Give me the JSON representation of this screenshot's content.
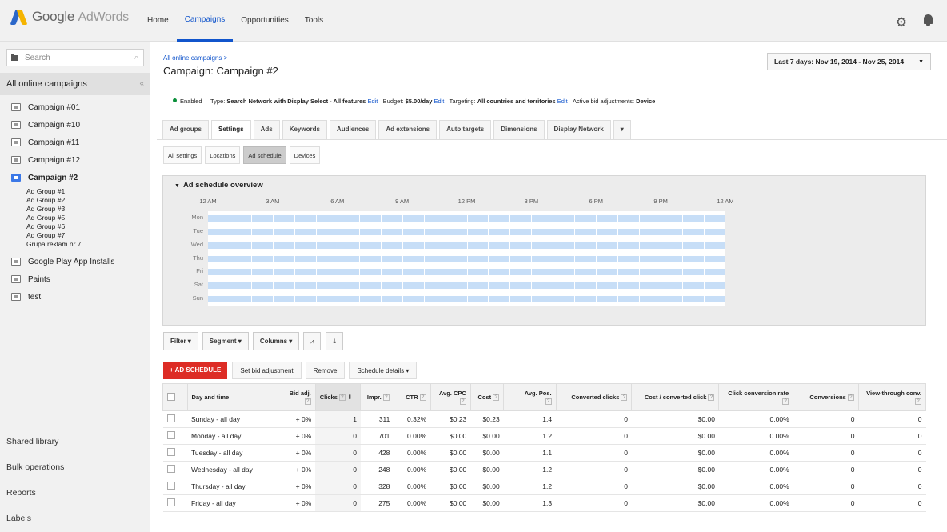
{
  "topbar": {
    "logo_google": "Google",
    "logo_product": "AdWords",
    "nav": [
      "Home",
      "Campaigns",
      "Opportunities",
      "Tools"
    ],
    "active_nav": "Campaigns"
  },
  "sidebar": {
    "search_placeholder": "Search",
    "all_campaigns": "All online campaigns",
    "collapse_glyph": "«",
    "campaigns": [
      {
        "name": "Campaign #01"
      },
      {
        "name": "Campaign #10"
      },
      {
        "name": "Campaign #11"
      },
      {
        "name": "Campaign #12"
      },
      {
        "name": "Campaign #2",
        "selected": true
      }
    ],
    "ad_groups": [
      "Ad Group #1",
      "Ad Group #2",
      "Ad Group #3",
      "Ad Group #5",
      "Ad Group #6",
      "Ad Group #7",
      "Grupa reklam nr 7"
    ],
    "other_campaigns": [
      "Google Play App Installs",
      "Paints",
      "test"
    ],
    "bottom": [
      "Shared library",
      "Bulk operations",
      "Reports",
      "Labels"
    ]
  },
  "main": {
    "breadcrumb": "All online campaigns >",
    "title": "Campaign: Campaign #2",
    "date_range": "Last 7 days: Nov 19, 2014 - Nov 25, 2014",
    "status": {
      "state": "Enabled",
      "type_label": "Type:",
      "type_value": "Search Network with Display Select - All features",
      "edit": "Edit",
      "budget_label": "Budget:",
      "budget_value": "$5.00/day",
      "targeting_label": "Targeting:",
      "targeting_value": "All countries and territories",
      "bid_label": "Active bid adjustments:",
      "bid_value": "Device"
    },
    "tabs": [
      "Ad groups",
      "Settings",
      "Ads",
      "Keywords",
      "Audiences",
      "Ad extensions",
      "Auto targets",
      "Dimensions",
      "Display Network",
      "▾"
    ],
    "active_tab": "Settings",
    "subtabs": [
      "All settings",
      "Locations",
      "Ad schedule",
      "Devices"
    ],
    "active_subtab": "Ad schedule"
  },
  "schedule": {
    "title": "Ad schedule overview",
    "hours": [
      "12 AM",
      "3 AM",
      "6 AM",
      "9 AM",
      "12 PM",
      "3 PM",
      "6 PM",
      "9 PM",
      "12 AM"
    ],
    "days": [
      "Mon",
      "Tue",
      "Wed",
      "Thu",
      "Fri",
      "Sat",
      "Sun"
    ]
  },
  "toolbar": {
    "filter": "Filter ▾",
    "segment": "Segment ▾",
    "columns": "Columns ▾",
    "chart_glyph": "⩘",
    "download_glyph": "⤓"
  },
  "actions": {
    "add": "+ AD SCHEDULE",
    "set_bid": "Set bid adjustment",
    "remove": "Remove",
    "details": "Schedule details ▾"
  },
  "table": {
    "headers": [
      "Day and time",
      "Bid adj.",
      "Clicks",
      "Impr.",
      "CTR",
      "Avg. CPC",
      "Cost",
      "Avg. Pos.",
      "Converted clicks",
      "Cost / converted click",
      "Click conversion rate",
      "Conversions",
      "View-through conv."
    ],
    "help_glyph": "?",
    "sort_glyph": "⬇",
    "rows": [
      [
        "Sunday - all day",
        "+ 0%",
        "1",
        "311",
        "0.32%",
        "$0.23",
        "$0.23",
        "1.4",
        "0",
        "$0.00",
        "0.00%",
        "0",
        "0"
      ],
      [
        "Monday - all day",
        "+ 0%",
        "0",
        "701",
        "0.00%",
        "$0.00",
        "$0.00",
        "1.2",
        "0",
        "$0.00",
        "0.00%",
        "0",
        "0"
      ],
      [
        "Tuesday - all day",
        "+ 0%",
        "0",
        "428",
        "0.00%",
        "$0.00",
        "$0.00",
        "1.1",
        "0",
        "$0.00",
        "0.00%",
        "0",
        "0"
      ],
      [
        "Wednesday - all day",
        "+ 0%",
        "0",
        "248",
        "0.00%",
        "$0.00",
        "$0.00",
        "1.2",
        "0",
        "$0.00",
        "0.00%",
        "0",
        "0"
      ],
      [
        "Thursday - all day",
        "+ 0%",
        "0",
        "328",
        "0.00%",
        "$0.00",
        "$0.00",
        "1.2",
        "0",
        "$0.00",
        "0.00%",
        "0",
        "0"
      ],
      [
        "Friday - all day",
        "+ 0%",
        "0",
        "275",
        "0.00%",
        "$0.00",
        "$0.00",
        "1.3",
        "0",
        "$0.00",
        "0.00%",
        "0",
        "0"
      ]
    ]
  },
  "colors": {
    "accent": "#1155cc",
    "add_button": "#dd2c25",
    "schedule_bar": "#c7def7",
    "enabled_dot": "#0a8f3a"
  },
  "icons": [
    "settings-gear-icon",
    "notification-bell-icon",
    "folder-icon",
    "search-icon",
    "campaign-icon",
    "chart-icon",
    "download-icon",
    "help-icon",
    "sort-arrow-icon",
    "dropdown-arrow-icon"
  ]
}
